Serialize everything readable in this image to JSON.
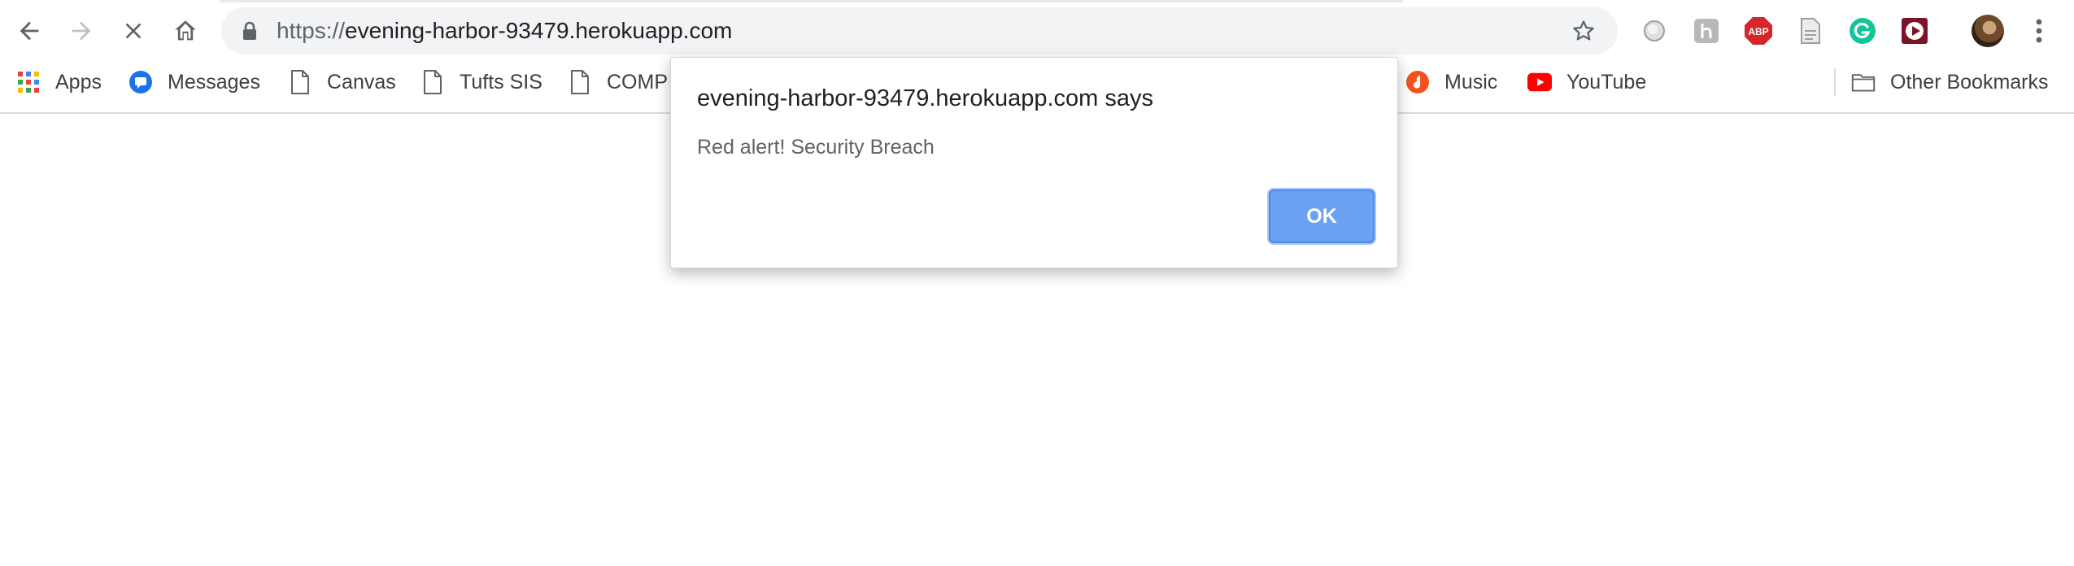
{
  "omnibox": {
    "scheme": "https://",
    "host": "evening-harbor-93479.herokuapp.com"
  },
  "extensions": {
    "abp_label": "ABP"
  },
  "bookmarks": {
    "items": [
      {
        "label": "Apps",
        "icon": "apps-grid-icon"
      },
      {
        "label": "Messages",
        "icon": "messages-icon"
      },
      {
        "label": "Canvas",
        "icon": "page-icon"
      },
      {
        "label": "Tufts SIS",
        "icon": "page-icon"
      },
      {
        "label": "COMP",
        "icon": "page-icon"
      },
      {
        "label": "Music",
        "icon": "music-icon"
      },
      {
        "label": "YouTube",
        "icon": "youtube-icon"
      }
    ],
    "other": {
      "label": "Other Bookmarks",
      "icon": "folder-icon"
    }
  },
  "dialog": {
    "title": "evening-harbor-93479.herokuapp.com says",
    "message": "Red alert! Security Breach",
    "ok_label": "OK",
    "ok_color": "#6ba1f2"
  }
}
